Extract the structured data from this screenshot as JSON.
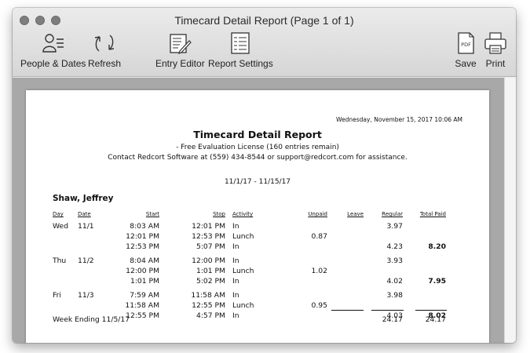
{
  "window": {
    "title": "Timecard Detail Report  (Page 1 of 1)"
  },
  "toolbar": {
    "people_dates": "People & Dates",
    "refresh": "Refresh",
    "entry_editor": "Entry Editor",
    "report_settings": "Report Settings",
    "save": "Save",
    "print": "Print",
    "pdf_badge": "PDF"
  },
  "report": {
    "timestamp": "Wednesday, November 15, 2017  10:06 AM",
    "title": "Timecard Detail Report",
    "license": "- Free Evaluation License (160 entries remain)",
    "contact": "Contact Redcort Software at (559) 434-8544 or support@redcort.com for assistance.",
    "date_range": "11/1/17 - 11/15/17",
    "employee": "Shaw, Jeffrey",
    "headers": {
      "day": "Day",
      "date": "Date",
      "start": "Start",
      "stop": "Stop",
      "activity": "Activity",
      "unpaid": "Unpaid",
      "leave": "Leave",
      "regular": "Regular",
      "total_paid": "Total Paid"
    },
    "rows": [
      {
        "day": "Wed",
        "date": "11/1",
        "start": "8:03 AM",
        "stop": "12:01 PM",
        "activity": "In",
        "unpaid": "",
        "regular": "3.97",
        "total": ""
      },
      {
        "day": "",
        "date": "",
        "start": "12:01 PM",
        "stop": "12:53 PM",
        "activity": "Lunch",
        "unpaid": "0.87",
        "regular": "",
        "total": ""
      },
      {
        "day": "",
        "date": "",
        "start": "12:53 PM",
        "stop": "5:07 PM",
        "activity": "In",
        "unpaid": "",
        "regular": "4.23",
        "total": "8.20"
      },
      {
        "day": "Thu",
        "date": "11/2",
        "start": "8:04 AM",
        "stop": "12:00 PM",
        "activity": "In",
        "unpaid": "",
        "regular": "3.93",
        "total": ""
      },
      {
        "day": "",
        "date": "",
        "start": "12:00 PM",
        "stop": "1:01 PM",
        "activity": "Lunch",
        "unpaid": "1.02",
        "regular": "",
        "total": ""
      },
      {
        "day": "",
        "date": "",
        "start": "1:01 PM",
        "stop": "5:02 PM",
        "activity": "In",
        "unpaid": "",
        "regular": "4.02",
        "total": "7.95"
      },
      {
        "day": "Fri",
        "date": "11/3",
        "start": "7:59 AM",
        "stop": "11:58 AM",
        "activity": "In",
        "unpaid": "",
        "regular": "3.98",
        "total": ""
      },
      {
        "day": "",
        "date": "",
        "start": "11:58 AM",
        "stop": "12:55 PM",
        "activity": "Lunch",
        "unpaid": "0.95",
        "regular": "",
        "total": ""
      },
      {
        "day": "",
        "date": "",
        "start": "12:55 PM",
        "stop": "4:57 PM",
        "activity": "In",
        "unpaid": "",
        "regular": "4.03",
        "total": "8.02"
      }
    ],
    "week_ending": {
      "label": "Week Ending 11/5/17",
      "regular": "24.17",
      "total": "24.17"
    }
  }
}
